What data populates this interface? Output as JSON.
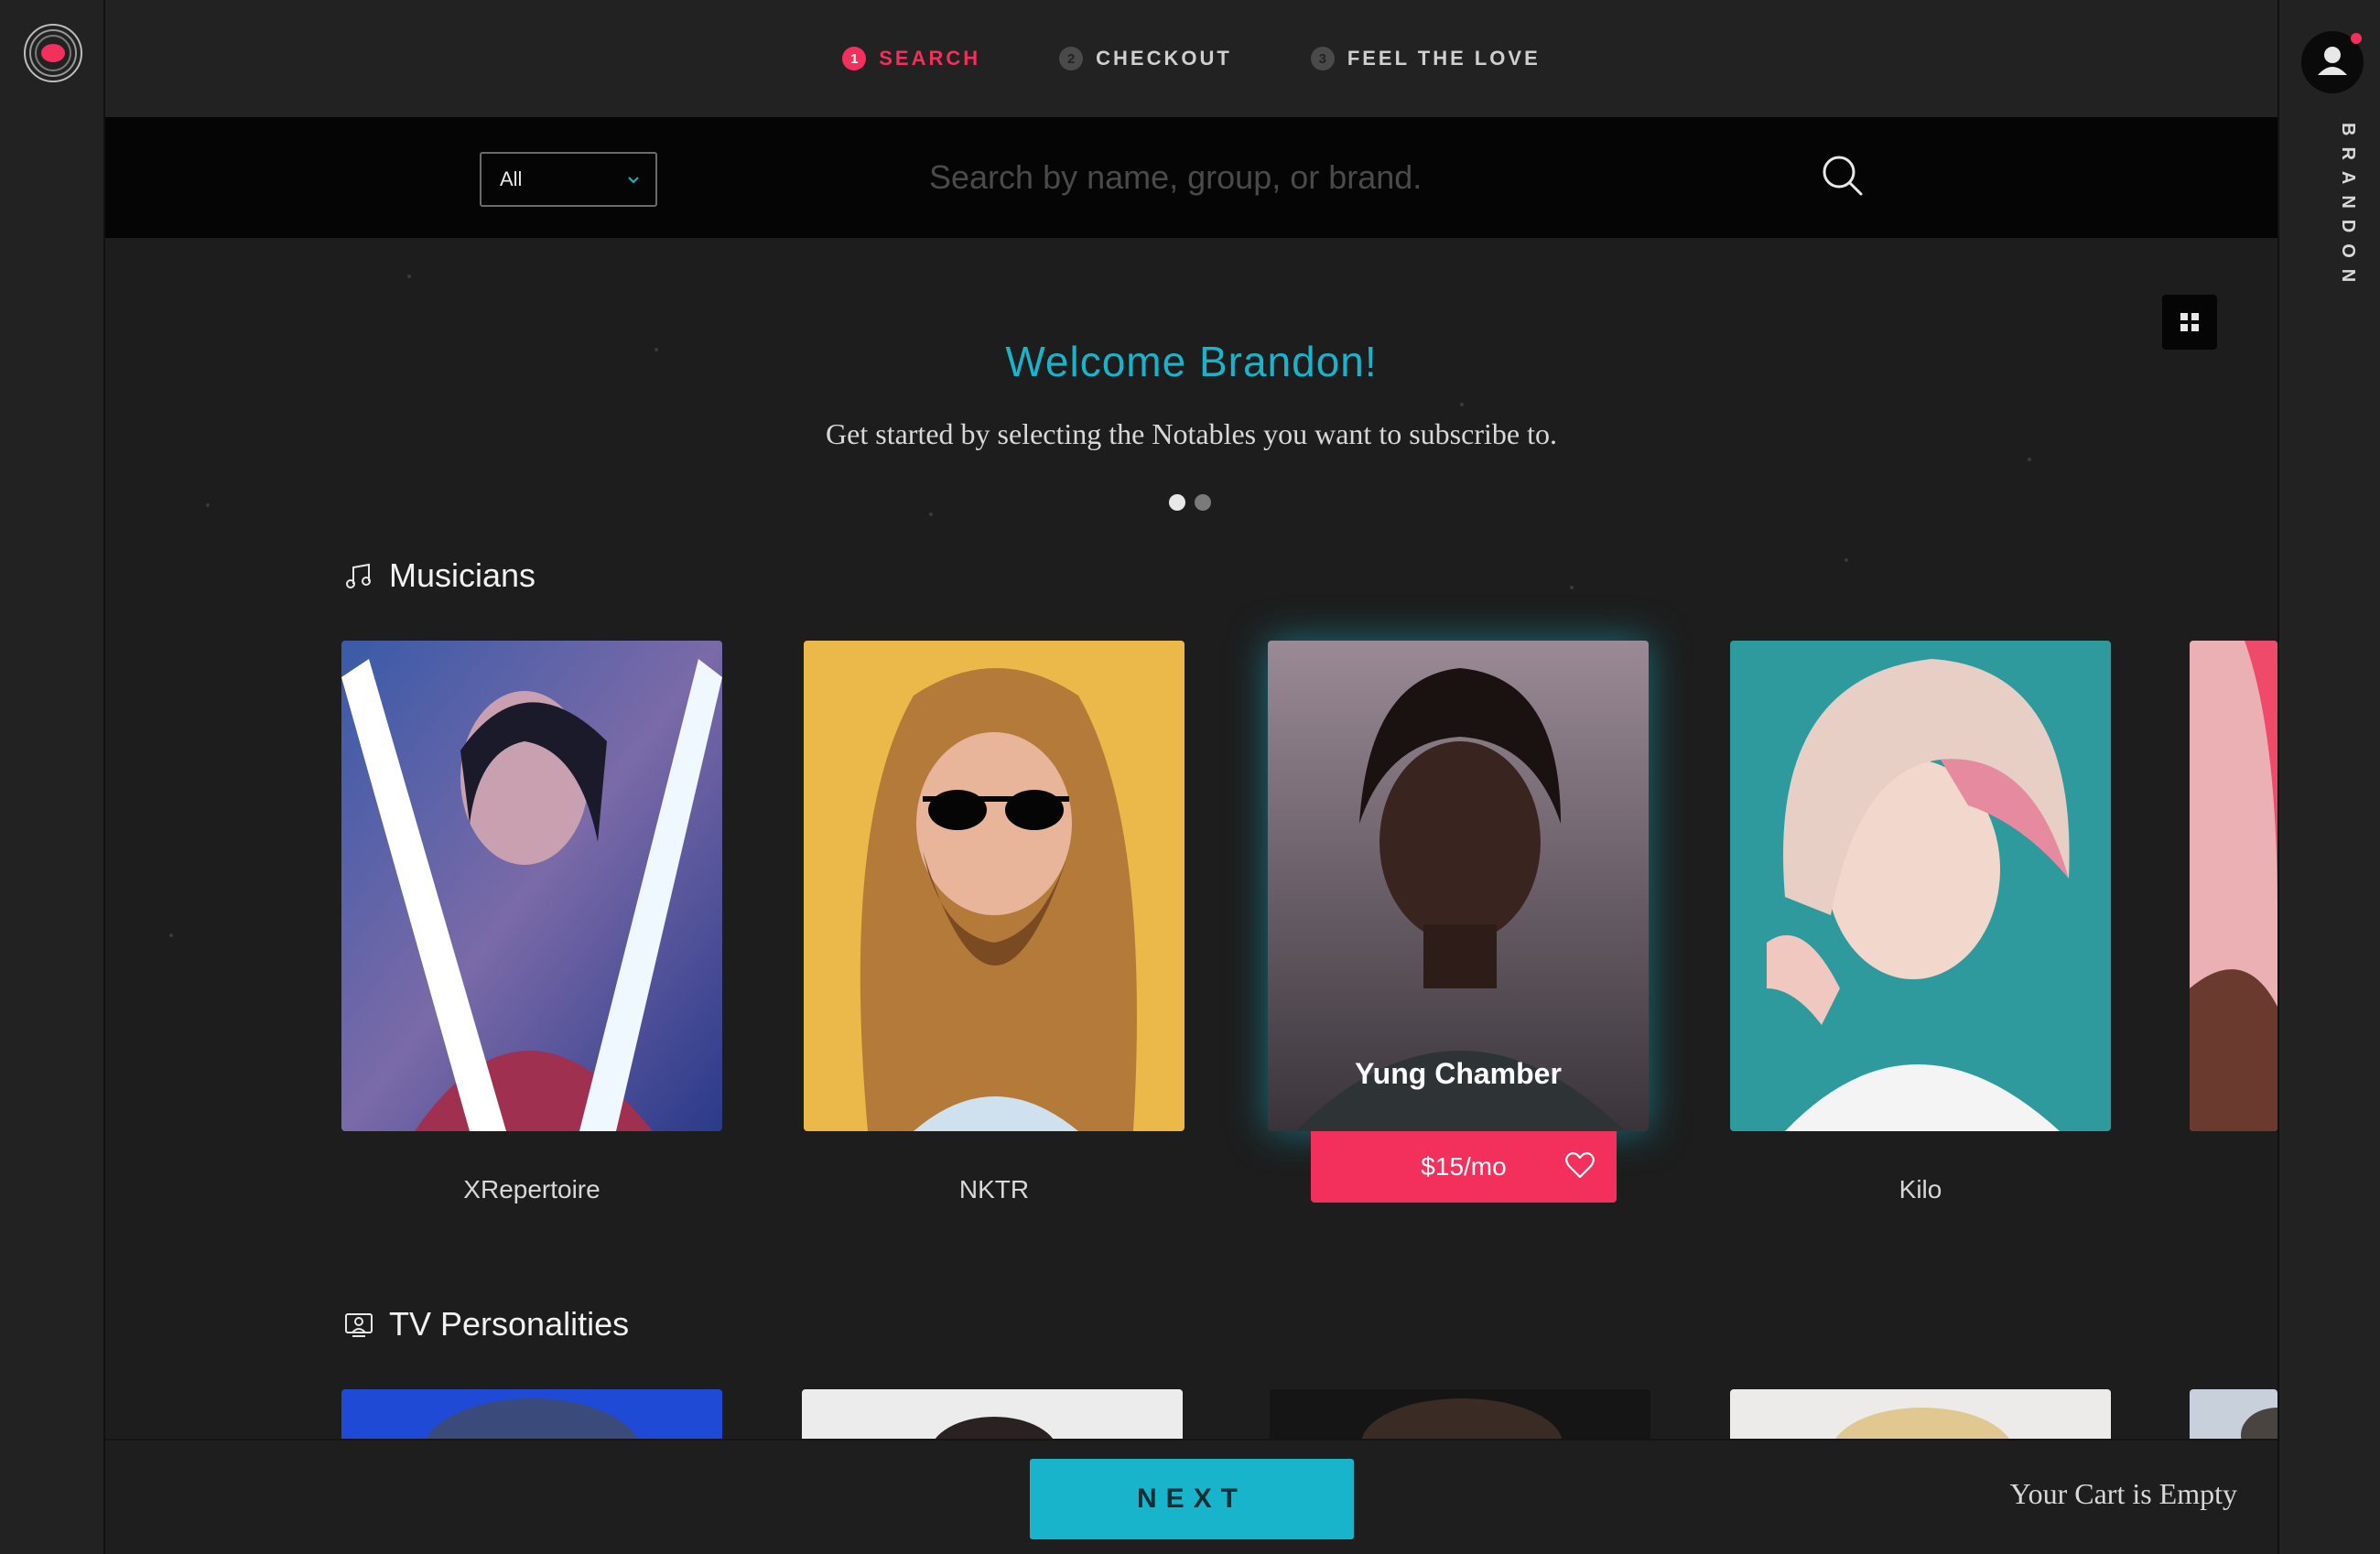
{
  "steps": [
    {
      "num": "1",
      "label": "SEARCH"
    },
    {
      "num": "2",
      "label": "CHECKOUT"
    },
    {
      "num": "3",
      "label": "FEEL THE LOVE"
    }
  ],
  "search": {
    "category_value": "All",
    "placeholder": "Search by name, group, or brand."
  },
  "user": {
    "name": "BRANDON"
  },
  "welcome": {
    "title": "Welcome Brandon!",
    "subtitle": "Get started by selecting the Notables you want to subscribe to."
  },
  "sections": {
    "musicians": {
      "title": "Musicians",
      "cards": [
        {
          "name": "XRepertoire"
        },
        {
          "name": "NKTR"
        },
        {
          "name": "Yung Chamber",
          "price": "$15/mo"
        },
        {
          "name": "Kilo"
        }
      ]
    },
    "tv": {
      "title": "TV Personalities"
    }
  },
  "footer": {
    "next_label": "NEXT",
    "cart_status": "Your Cart is Empty"
  },
  "colors": {
    "accent_pink": "#f2305b",
    "accent_teal": "#18b4cc",
    "background": "#1d1d1d"
  },
  "icons": [
    "logo-icon",
    "user-icon",
    "search-icon",
    "chevron-down-icon",
    "grid-view-icon",
    "music-note-icon",
    "tv-icon",
    "heart-icon"
  ]
}
